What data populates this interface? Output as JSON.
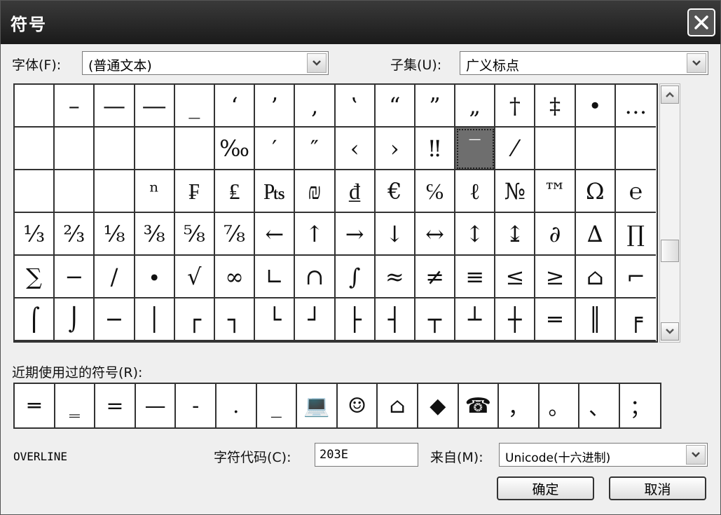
{
  "window": {
    "title": "符号"
  },
  "font_label": "字体(F):",
  "font_value": "(普通文本)",
  "subset_label": "子集(U):",
  "subset_value": "广义标点",
  "symbols": [
    [
      "",
      "–",
      "—",
      "―",
      "_",
      "‘",
      "’",
      "‚",
      "‛",
      "“",
      "”",
      "„",
      "†",
      "‡",
      "•",
      "…"
    ],
    [
      "",
      "",
      "",
      "",
      "",
      "‰",
      "′",
      "″",
      "‹",
      "›",
      "‼",
      "‾",
      "⁄",
      "",
      "",
      ""
    ],
    [
      "",
      "",
      "",
      "ⁿ",
      "₣",
      "₤",
      "₧",
      "₪",
      "₫",
      "€",
      "℅",
      "ℓ",
      "№",
      "™",
      "Ω",
      "℮"
    ],
    [
      "⅓",
      "⅔",
      "⅛",
      "⅜",
      "⅝",
      "⅞",
      "←",
      "↑",
      "→",
      "↓",
      "↔",
      "↕",
      "↨",
      "∂",
      "∆",
      "∏"
    ],
    [
      "∑",
      "−",
      "∕",
      "∙",
      "√",
      "∞",
      "∟",
      "∩",
      "∫",
      "≈",
      "≠",
      "≡",
      "≤",
      "≥",
      "⌂",
      "⌐"
    ],
    [
      "⌠",
      "⌡",
      "─",
      "│",
      "┌",
      "┐",
      "└",
      "┘",
      "├",
      "┤",
      "┬",
      "┴",
      "┼",
      "═",
      "║",
      "╒"
    ]
  ],
  "selected_symbol": "‾",
  "recent_label": "近期使用过的符号(R):",
  "recent_symbols": [
    "═",
    "‗",
    "=",
    "—",
    "-",
    ".",
    "_",
    "💻",
    "☺",
    "⌂",
    "◆",
    "☎",
    "，",
    "。",
    "、",
    "；"
  ],
  "char_name": "OVERLINE",
  "char_code_label": "字符代码(C):",
  "char_code_value": "203E",
  "from_label": "来自(M):",
  "from_value": "Unicode(十六进制)",
  "ok_label": "确定",
  "cancel_label": "取消"
}
